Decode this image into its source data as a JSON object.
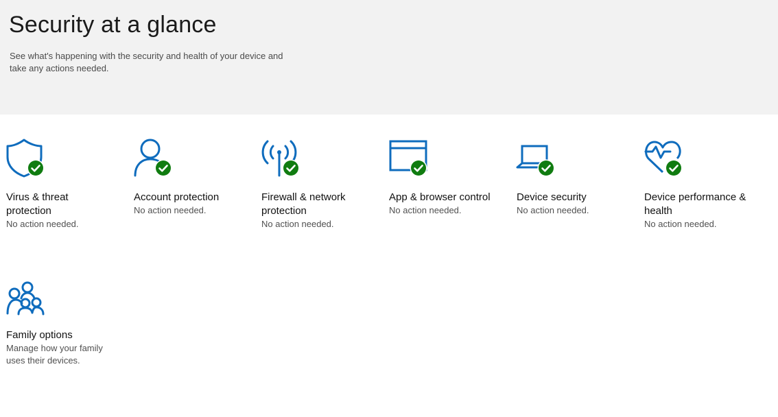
{
  "header": {
    "title": "Security at a glance",
    "subtitle": "See what's happening with the security and health of your device and take any actions needed."
  },
  "tiles": [
    {
      "title": "Virus & threat protection",
      "status": "No action needed.",
      "icon": "shield-icon",
      "badge": "check-badge-icon"
    },
    {
      "title": "Account protection",
      "status": "No action needed.",
      "icon": "person-icon",
      "badge": "check-badge-icon"
    },
    {
      "title": "Firewall & network protection",
      "status": "No action needed.",
      "icon": "antenna-icon",
      "badge": "check-badge-icon"
    },
    {
      "title": "App & browser control",
      "status": "No action needed.",
      "icon": "browser-window-icon",
      "badge": "check-badge-icon"
    },
    {
      "title": "Device security",
      "status": "No action needed.",
      "icon": "laptop-icon",
      "badge": "check-badge-icon"
    },
    {
      "title": "Device performance & health",
      "status": "No action needed.",
      "icon": "heart-pulse-icon",
      "badge": "check-badge-icon"
    },
    {
      "title": "Family options",
      "status": "Manage how your family uses their devices.",
      "icon": "family-icon"
    }
  ],
  "colors": {
    "header_bg": "#f2f2f2",
    "icon_blue": "#0f6cbd",
    "check_green": "#107c10"
  }
}
